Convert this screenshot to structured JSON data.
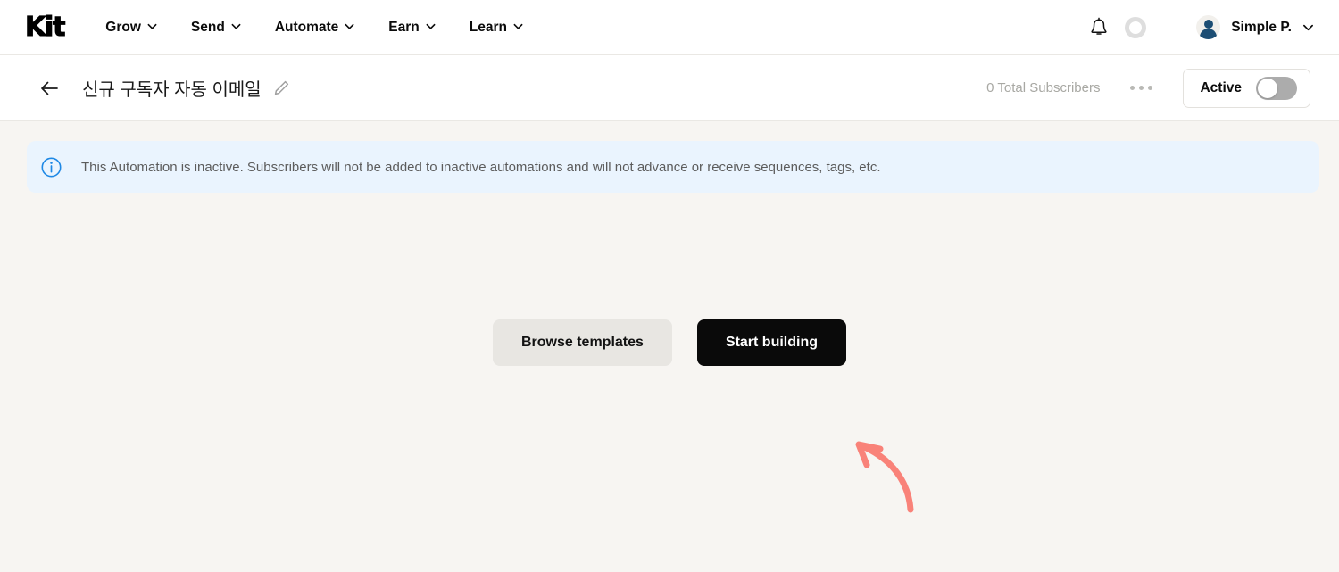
{
  "header": {
    "logo_text": "Kit",
    "nav": [
      {
        "label": "Grow",
        "icon": "chevron-down-icon"
      },
      {
        "label": "Send",
        "icon": "chevron-down-icon"
      },
      {
        "label": "Automate",
        "icon": "chevron-down-icon"
      },
      {
        "label": "Earn",
        "icon": "chevron-down-icon"
      },
      {
        "label": "Learn",
        "icon": "chevron-down-icon"
      }
    ],
    "notifications_icon": "bell-icon",
    "progress_ring_icon": "progress-ring-icon",
    "user": {
      "name": "Simple P.",
      "avatar_icon": "avatar-icon",
      "menu_icon": "chevron-down-icon"
    }
  },
  "subheader": {
    "back_icon": "back-arrow-icon",
    "title": "신규 구독자 자동 이메일",
    "edit_icon": "pencil-icon",
    "subscribers_label": "0 Total Subscribers",
    "more_icon": "more-horizontal-icon",
    "toggle": {
      "label": "Active",
      "state": "off"
    }
  },
  "banner": {
    "icon": "info-circle-icon",
    "text": "This Automation is inactive. Subscribers will not be added to inactive automations and will not advance or receive sequences, tags, etc.",
    "background_color": "#EAF4FE",
    "icon_color": "#1E88E5"
  },
  "main": {
    "browse_templates_label": "Browse templates",
    "start_building_label": "Start building",
    "annotation": {
      "icon": "curved-arrow-annotation",
      "color": "#F98279",
      "points_to": "start-building-button"
    }
  },
  "colors": {
    "page_background": "#F7F5F2",
    "surface": "#FFFFFF",
    "primary_button": "#0A0A0A",
    "secondary_button": "#E8E6E2",
    "muted_text": "#A8A8A3",
    "avatar": "#1D4E74"
  }
}
